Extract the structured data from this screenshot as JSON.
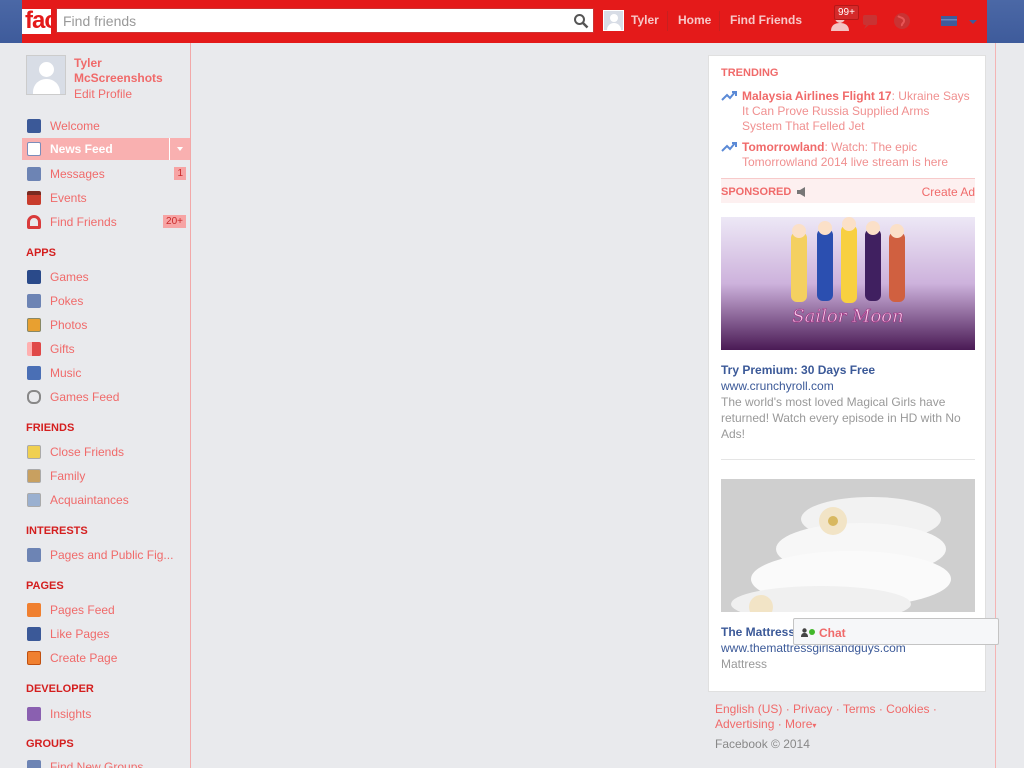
{
  "topbar": {
    "logo_text": "fac",
    "search_placeholder": "Find friends",
    "user_name": "Tyler",
    "home": "Home",
    "find_friends": "Find Friends",
    "notification_count": "99+"
  },
  "profile": {
    "name": "Tyler McScreenshots",
    "edit": "Edit Profile"
  },
  "nav": {
    "favorites": [
      {
        "label": "Welcome",
        "icon": "facebook-icon"
      },
      {
        "label": "News Feed",
        "icon": "news-feed-icon"
      },
      {
        "label": "Messages",
        "icon": "messages-icon",
        "count": "1"
      },
      {
        "label": "Events",
        "icon": "events-icon"
      },
      {
        "label": "Find Friends",
        "icon": "find-friends-icon",
        "count": "20+"
      }
    ],
    "apps_head": "APPS",
    "apps": [
      {
        "label": "Games",
        "icon": "games-icon"
      },
      {
        "label": "Pokes",
        "icon": "pokes-icon"
      },
      {
        "label": "Photos",
        "icon": "photos-icon"
      },
      {
        "label": "Gifts",
        "icon": "gifts-icon"
      },
      {
        "label": "Music",
        "icon": "music-icon"
      },
      {
        "label": "Games Feed",
        "icon": "games-feed-icon"
      }
    ],
    "friends_head": "FRIENDS",
    "friends": [
      {
        "label": "Close Friends",
        "icon": "star-icon"
      },
      {
        "label": "Family",
        "icon": "house-icon"
      },
      {
        "label": "Acquaintances",
        "icon": "people-icon"
      }
    ],
    "interests_head": "INTERESTS",
    "interests": [
      {
        "label": "Pages and Public Fig...",
        "icon": "rss-icon"
      }
    ],
    "pages_head": "PAGES",
    "pages": [
      {
        "label": "Pages Feed",
        "icon": "megaphone-icon"
      },
      {
        "label": "Like Pages",
        "icon": "thumbs-up-icon"
      },
      {
        "label": "Create Page",
        "icon": "plus-icon"
      }
    ],
    "developer_head": "DEVELOPER",
    "developer": [
      {
        "label": "Insights",
        "icon": "chart-icon"
      }
    ],
    "groups_head": "GROUPS",
    "groups": [
      {
        "label": "Find New Groups",
        "icon": "groups-icon"
      }
    ]
  },
  "trending": {
    "title": "TRENDING",
    "items": [
      {
        "topic": "Malaysia Airlines Flight 17",
        "text": ": Ukraine Says It Can Prove Russia Supplied Arms System That Felled Jet"
      },
      {
        "topic": "Tomorrowland",
        "text": ": Watch: The epic Tomorrowland 2014 live stream is here"
      }
    ]
  },
  "sponsored": {
    "label": "SPONSORED",
    "create_ad": "Create Ad",
    "ads": [
      {
        "title": "Try Premium: 30 Days Free",
        "url": "www.crunchyroll.com",
        "desc": "The world's most loved Magical Girls have returned! Watch every episode in HD with No Ads!",
        "image_text": "Sailor Moon"
      },
      {
        "title": "The Mattress",
        "url": "www.themattressgirlsandguys.com",
        "desc": "Mattress"
      }
    ]
  },
  "chat": {
    "label": "Chat"
  },
  "footer": {
    "links": [
      "English (US)",
      "Privacy",
      "Terms",
      "Cookies",
      "Advertising",
      "More"
    ],
    "copyright": "Facebook © 2014"
  },
  "colors": {
    "accent": "#e41a1a",
    "link": "#f06a6a",
    "ad_link": "#3b5998"
  }
}
